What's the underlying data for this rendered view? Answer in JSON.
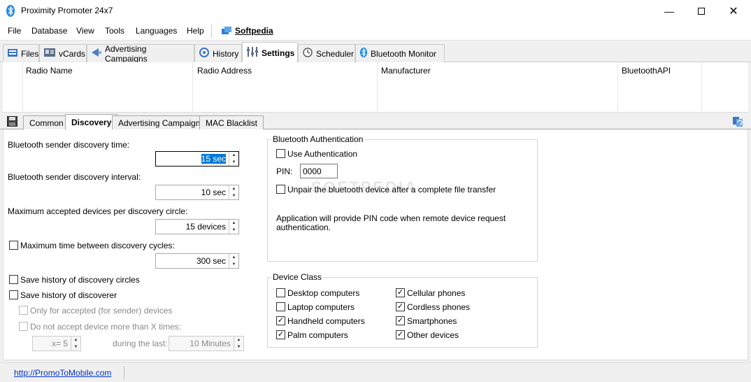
{
  "window": {
    "title": "Proximity Promoter 24x7"
  },
  "menu": {
    "items": [
      "File",
      "Database",
      "View",
      "Tools",
      "Languages",
      "Help"
    ],
    "brand": "Softpedia"
  },
  "main_tabs": [
    "Files",
    "vCards",
    "Advertising Campaigns",
    "History",
    "Settings",
    "Scheduler",
    "Bluetooth Monitor"
  ],
  "radio_table": {
    "columns": [
      "Radio Name",
      "Radio Address",
      "Manufacturer",
      "BluetoothAPI"
    ]
  },
  "sub_tabs": [
    "Common",
    "Discovery",
    "Advertising Campaign",
    "MAC Blacklist"
  ],
  "discovery": {
    "sender_time_label": "Bluetooth sender discovery time:",
    "sender_time_value": "15 sec",
    "sender_interval_label": "Bluetooth sender discovery interval:",
    "sender_interval_value": "10 sec",
    "max_devices_label": "Maximum accepted devices per discovery circle:",
    "max_devices_value": "15 devices",
    "max_time_label": "Maximum time between discovery cycles:",
    "max_time_value": "300 sec",
    "save_circles_label": "Save history of discovery circles",
    "save_discoverer_label": "Save history of discoverer",
    "only_accepted_label": "Only for accepted (for sender) devices",
    "no_more_than_label": "Do not accept device more than X times:",
    "x_value": "x= 5",
    "during_last_label": "during the last:",
    "minutes_value": "10 Minutes"
  },
  "auth": {
    "group_title": "Bluetooth Authentication",
    "use_auth_label": "Use Authentication",
    "pin_label": "PIN:",
    "pin_value": "0000",
    "unpair_label": "Unpair the bluetooth device after a complete file transfer",
    "note_line1": "Application will provide PIN code when remote device request",
    "note_line2": "authentication."
  },
  "device_class": {
    "group_title": "Device Class",
    "left": [
      {
        "label": "Desktop computers",
        "checked": false
      },
      {
        "label": "Laptop computers",
        "checked": false
      },
      {
        "label": "Handheld computers",
        "checked": true
      },
      {
        "label": "Palm computers",
        "checked": true
      }
    ],
    "right": [
      {
        "label": "Cellular phones",
        "checked": true
      },
      {
        "label": "Cordless phones",
        "checked": true
      },
      {
        "label": "Smartphones",
        "checked": true
      },
      {
        "label": "Other devices",
        "checked": true
      }
    ]
  },
  "status": {
    "link": "http://PromoToMobile.com"
  },
  "watermark": "SOFTPEDIA",
  "colors": {
    "accent": "#0078d7",
    "link": "#0033cc",
    "bluetooth": "#1e88e5"
  },
  "icons": [
    "bluetooth-icon",
    "files-icon",
    "vcards-icon",
    "campaigns-icon",
    "history-icon",
    "settings-icon",
    "scheduler-icon",
    "bluetooth-monitor-icon",
    "save-icon",
    "refresh-icon",
    "softpedia-icon"
  ]
}
